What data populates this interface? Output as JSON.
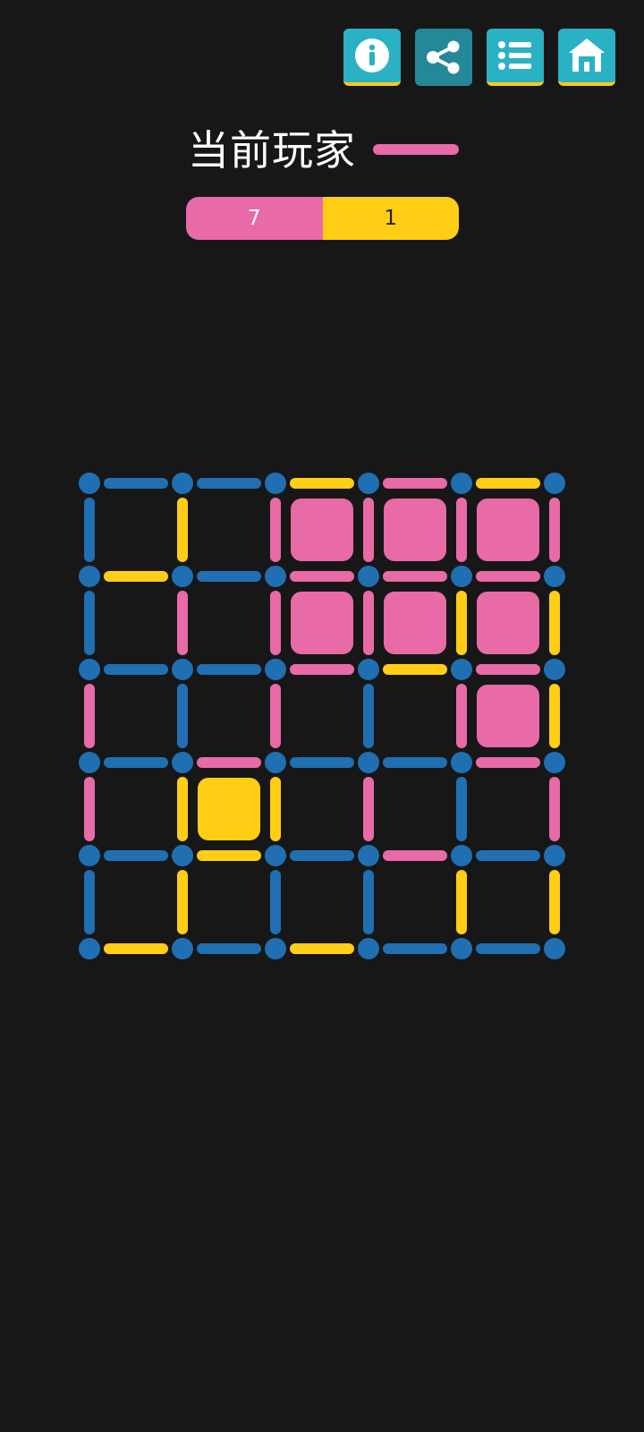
{
  "colors": {
    "background": "#171717",
    "player1": "#e86aa6",
    "player2": "#ffce15",
    "neutral": "#1f6fb2",
    "button": "#2bb1c4",
    "button_active": "#248899",
    "icon": "#ffffff"
  },
  "header": {
    "buttons": [
      {
        "name": "info-button",
        "icon": "info-icon"
      },
      {
        "name": "share-button",
        "icon": "share-icon"
      },
      {
        "name": "menu-button",
        "icon": "list-icon"
      },
      {
        "name": "home-button",
        "icon": "home-icon"
      }
    ]
  },
  "status": {
    "current_player_label": "当前玩家",
    "current_player": "player1"
  },
  "score": {
    "player1": "7",
    "player2": "1"
  },
  "board": {
    "cols": 5,
    "rows": 5,
    "h_edges": [
      [
        "n",
        "n",
        "y",
        "p",
        "y"
      ],
      [
        "y",
        "n",
        "p",
        "p",
        "p"
      ],
      [
        "n",
        "n",
        "p",
        "y",
        "p"
      ],
      [
        "n",
        "p",
        "n",
        "n",
        "p"
      ],
      [
        "n",
        "y",
        "n",
        "p",
        "n"
      ],
      [
        "y",
        "n",
        "y",
        "n",
        "n"
      ]
    ],
    "v_edges": [
      [
        "n",
        "y",
        "p",
        "p",
        "p",
        "p"
      ],
      [
        "n",
        "p",
        "p",
        "p",
        "y",
        "y"
      ],
      [
        "p",
        "n",
        "p",
        "n",
        "p",
        "y"
      ],
      [
        "p",
        "y",
        "y",
        "p",
        "n",
        "p"
      ],
      [
        "n",
        "y",
        "n",
        "n",
        "y",
        "y"
      ]
    ],
    "boxes": [
      [
        "",
        "",
        "p",
        "p",
        "p"
      ],
      [
        "",
        "",
        "p",
        "p",
        "p"
      ],
      [
        "",
        "",
        "",
        "",
        "p"
      ],
      [
        "",
        "y",
        "",
        "",
        ""
      ],
      [
        "",
        "",
        "",
        "",
        ""
      ]
    ]
  }
}
